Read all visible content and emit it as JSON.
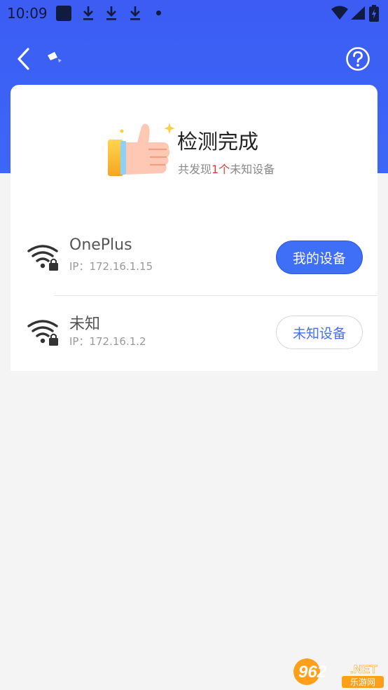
{
  "status_bar": {
    "time": "10:09"
  },
  "icons": {
    "back": "back-arrow-icon",
    "help": "help-circle-icon",
    "thumb": "thumbs-up-icon",
    "wifi_locked": "wifi-lock-icon"
  },
  "result": {
    "title": "检测完成",
    "subtitle_prefix": "共发现",
    "count": "1个",
    "subtitle_suffix": "未知设备"
  },
  "devices": [
    {
      "name": "OnePlus",
      "ip": "IP：172.16.1.15",
      "tag": "我的设备"
    },
    {
      "name": "未知",
      "ip": "IP：172.16.1.2",
      "tag": "未知设备"
    }
  ],
  "watermark": {
    "number": "962",
    "suffix": ".NET",
    "caption": "乐游网"
  },
  "colors": {
    "header": "#3d60f5",
    "primary_button": "#3f6ef7",
    "count_highlight": "#e53935",
    "outline_button_text": "#4670e9"
  }
}
